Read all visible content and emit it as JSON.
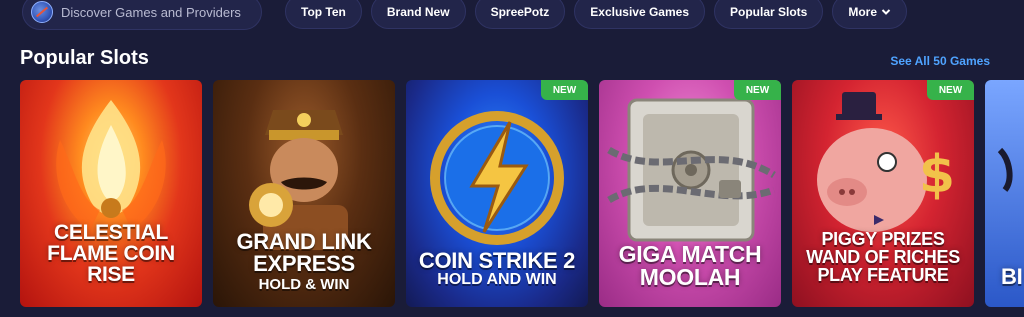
{
  "search": {
    "placeholder": "Discover Games and Providers"
  },
  "nav": {
    "items": [
      {
        "label": "Top Ten"
      },
      {
        "label": "Brand New"
      },
      {
        "label": "SpreePotz"
      },
      {
        "label": "Exclusive Games"
      },
      {
        "label": "Popular Slots"
      },
      {
        "label": "More"
      }
    ]
  },
  "section": {
    "title": "Popular Slots",
    "see_all": "See All 50 Games"
  },
  "games": [
    {
      "title_lines": [
        "CELESTIAL",
        "FLAME COIN",
        "RISE"
      ],
      "sub": "",
      "badge": ""
    },
    {
      "title_lines": [
        "GRAND LINK",
        "EXPRESS"
      ],
      "sub": "HOLD & WIN",
      "badge": ""
    },
    {
      "title_lines": [
        "COIN STRIKE 2"
      ],
      "sub": "HOLD AND WIN",
      "badge": "NEW"
    },
    {
      "title_lines": [
        "GIGA MATCH",
        "MOOLAH"
      ],
      "sub": "",
      "badge": "NEW"
    },
    {
      "title_lines": [
        "PIGGY PRIZES",
        "WAND OF RICHES",
        "PLAY FEATURE"
      ],
      "sub": "",
      "badge": "NEW"
    },
    {
      "title_lines": [
        "BI"
      ],
      "sub": "",
      "badge": ""
    }
  ],
  "colors": {
    "background": "#1a1c38",
    "pill": "#22254a",
    "accent_link": "#4fa3ff",
    "badge_new": "#36b24a"
  },
  "icons": {
    "search": "search-globe-icon",
    "more": "chevron-down-icon"
  }
}
